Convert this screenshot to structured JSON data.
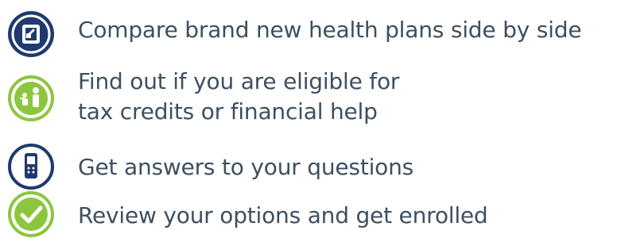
{
  "colors": {
    "navy": "#1f3a6e",
    "green": "#8cc63f",
    "text": "#3d4f60"
  },
  "items": [
    {
      "icon": "compare-plans-icon",
      "lines": [
        "Compare brand new health plans side by side"
      ]
    },
    {
      "icon": "family-help-icon",
      "lines": [
        "Find out if you are eligible for",
        "tax credits or financial help"
      ]
    },
    {
      "icon": "phone-icon",
      "lines": [
        "Get answers to your questions"
      ]
    },
    {
      "icon": "checkmark-icon",
      "lines": [
        "Review your options and get enrolled"
      ]
    }
  ]
}
